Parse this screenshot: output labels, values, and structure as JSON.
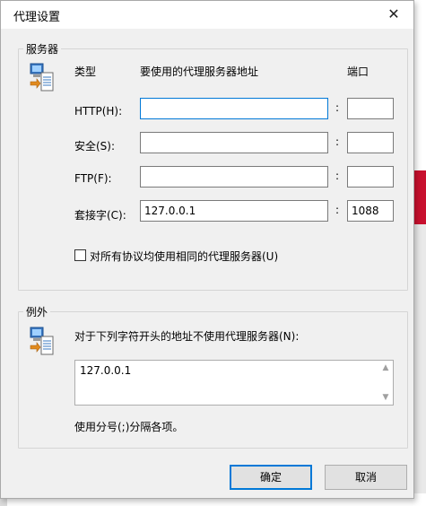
{
  "window": {
    "title": "代理设置",
    "close_glyph": "✕"
  },
  "servers": {
    "legend": "服务器",
    "icon": "network-computer-icon",
    "col_type": "类型",
    "col_address": "要使用的代理服务器地址",
    "col_port": "端口",
    "rows": [
      {
        "label": "HTTP(H):",
        "address": "",
        "port": ""
      },
      {
        "label": "安全(S):",
        "address": "",
        "port": ""
      },
      {
        "label": "FTP(F):",
        "address": "",
        "port": ""
      },
      {
        "label": "套接字(C):",
        "address": "127.0.0.1",
        "port": "1088"
      }
    ],
    "colon": ":",
    "same_proxy_label": "对所有协议均使用相同的代理服务器(U)",
    "same_proxy_checked": false
  },
  "exceptions": {
    "legend": "例外",
    "icon": "network-computer-icon",
    "description": "对于下列字符开头的地址不使用代理服务器(N):",
    "list_value": "127.0.0.1",
    "hint": "使用分号(;)分隔各项。"
  },
  "buttons": {
    "ok": "确定",
    "cancel": "取消"
  },
  "colors": {
    "accent": "#0078d7",
    "dialog_bg": "#f0f0f0"
  }
}
